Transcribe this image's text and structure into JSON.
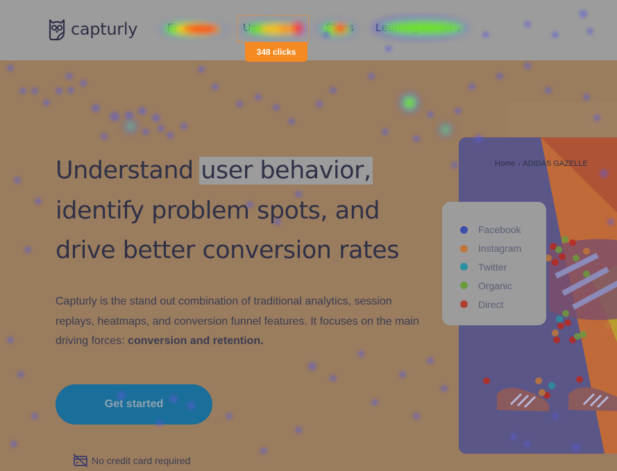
{
  "header": {
    "logo_text": "capturly",
    "nav": [
      {
        "label": "Features"
      },
      {
        "label": "Use cases"
      },
      {
        "label": "Plans"
      },
      {
        "label": "Learning center",
        "chevron": "⌄"
      }
    ]
  },
  "heatmap_tooltip": {
    "label": "348 clicks",
    "target": "Use cases"
  },
  "hero": {
    "title_line1_pre": "Understand ",
    "title_line1_mark": "user behavior,",
    "title_line2": "identify problem spots, and",
    "title_line3": "drive better conversion rates",
    "desc_line1": "Capturly is the stand out combination of traditional analytics, session",
    "desc_line2": "replays, heatmaps, and conversion funnel features. It focuses on the main",
    "desc_line3_pre": "driving forces: ",
    "desc_line3_bold": "conversion and retention.",
    "cta_label": "Get started",
    "no_card_label": "No credit card required",
    "no_card_icon": "no-credit-card-icon"
  },
  "product_preview": {
    "breadcrumb_home": "Home",
    "breadcrumb_sep": "›",
    "breadcrumb_current": "ADIDAS GAZELLE"
  },
  "legend": {
    "items": [
      {
        "label": "Facebook",
        "color": "#3d4fa8"
      },
      {
        "label": "Instagram",
        "color": "#c0763a"
      },
      {
        "label": "Twitter",
        "color": "#2a8fa0"
      },
      {
        "label": "Organic",
        "color": "#6c9a3e"
      },
      {
        "label": "Direct",
        "color": "#b0402f"
      }
    ]
  },
  "colors": {
    "header_bg": "#9c9c9c",
    "page_bg": "#9a7c5e",
    "accent_orange": "#f68a22",
    "cta_bg": "#1a6e9a",
    "text_dark": "#2f3147"
  }
}
